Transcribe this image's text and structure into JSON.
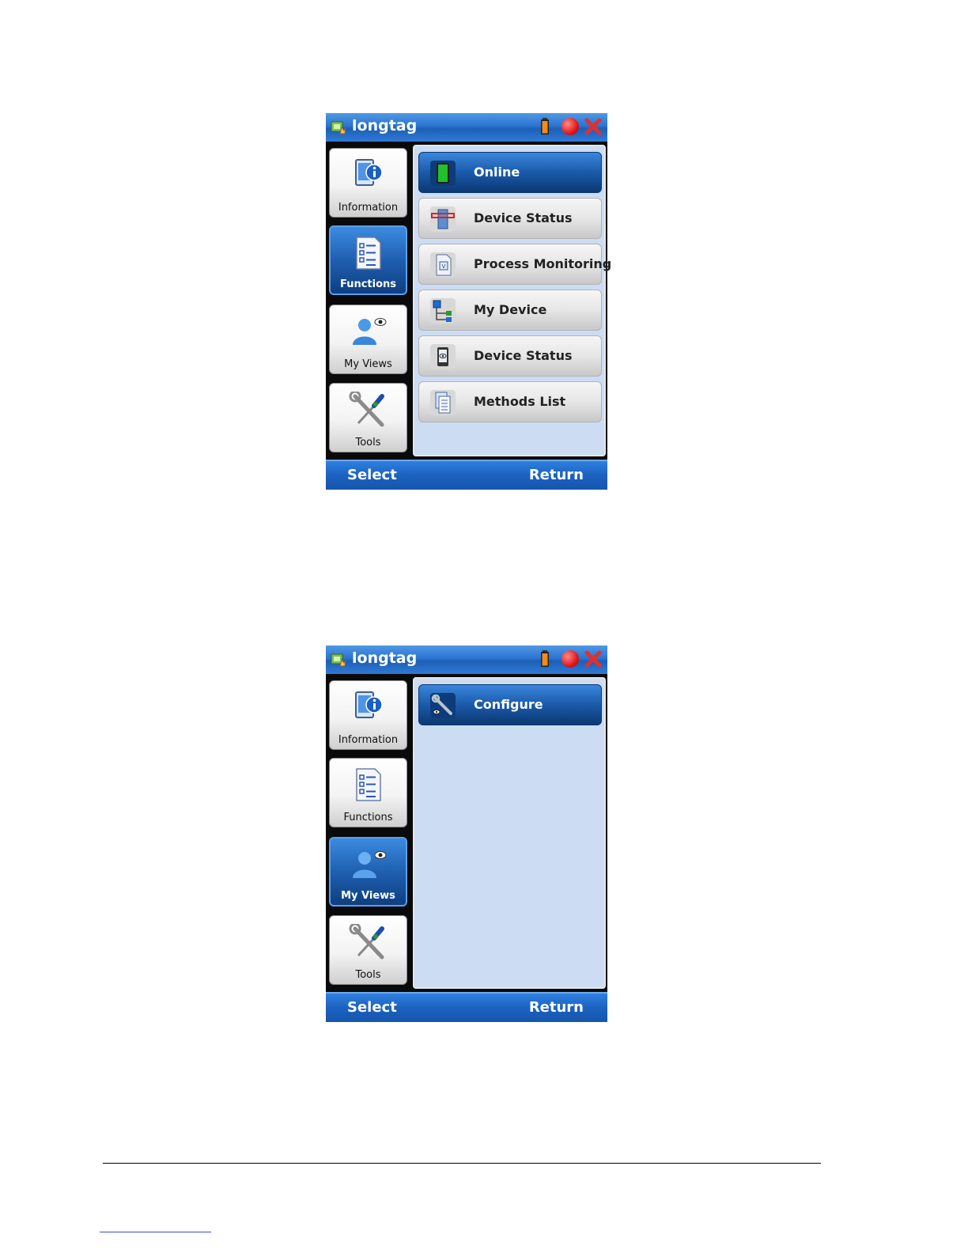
{
  "screens": [
    {
      "app_title": "longtag",
      "sidebar": [
        {
          "label": "Information",
          "icon": "information-icon",
          "active": false
        },
        {
          "label": "Functions",
          "icon": "functions-icon",
          "active": true
        },
        {
          "label": "My Views",
          "icon": "my-views-icon",
          "active": false
        },
        {
          "label": "Tools",
          "icon": "tools-icon",
          "active": false
        }
      ],
      "menu": [
        {
          "label": "Online",
          "icon": "online-icon",
          "active": true
        },
        {
          "label": "Device Status",
          "icon": "device-status-icon",
          "active": false
        },
        {
          "label": "Process Monitoring",
          "icon": "process-monitoring-icon",
          "active": false
        },
        {
          "label": "My Device",
          "icon": "my-device-icon",
          "active": false
        },
        {
          "label": "Device Status",
          "icon": "device-status-eye-icon",
          "active": false
        },
        {
          "label": "Methods List",
          "icon": "methods-list-icon",
          "active": false
        }
      ],
      "softkeys": {
        "left": "Select",
        "right": "Return"
      }
    },
    {
      "app_title": "longtag",
      "sidebar": [
        {
          "label": "Information",
          "icon": "information-icon",
          "active": false
        },
        {
          "label": "Functions",
          "icon": "functions-icon",
          "active": false
        },
        {
          "label": "My Views",
          "icon": "my-views-icon",
          "active": true
        },
        {
          "label": "Tools",
          "icon": "tools-icon",
          "active": false
        }
      ],
      "menu": [
        {
          "label": "Configure",
          "icon": "configure-wrench-icon",
          "active": true
        }
      ],
      "softkeys": {
        "left": "Select",
        "right": "Return"
      }
    }
  ],
  "colors": {
    "title_bar": "#2b74cf",
    "active_button": "#1b5aaa",
    "panel_background": "#ccdcf3",
    "online_indicator": "#22c02a"
  }
}
